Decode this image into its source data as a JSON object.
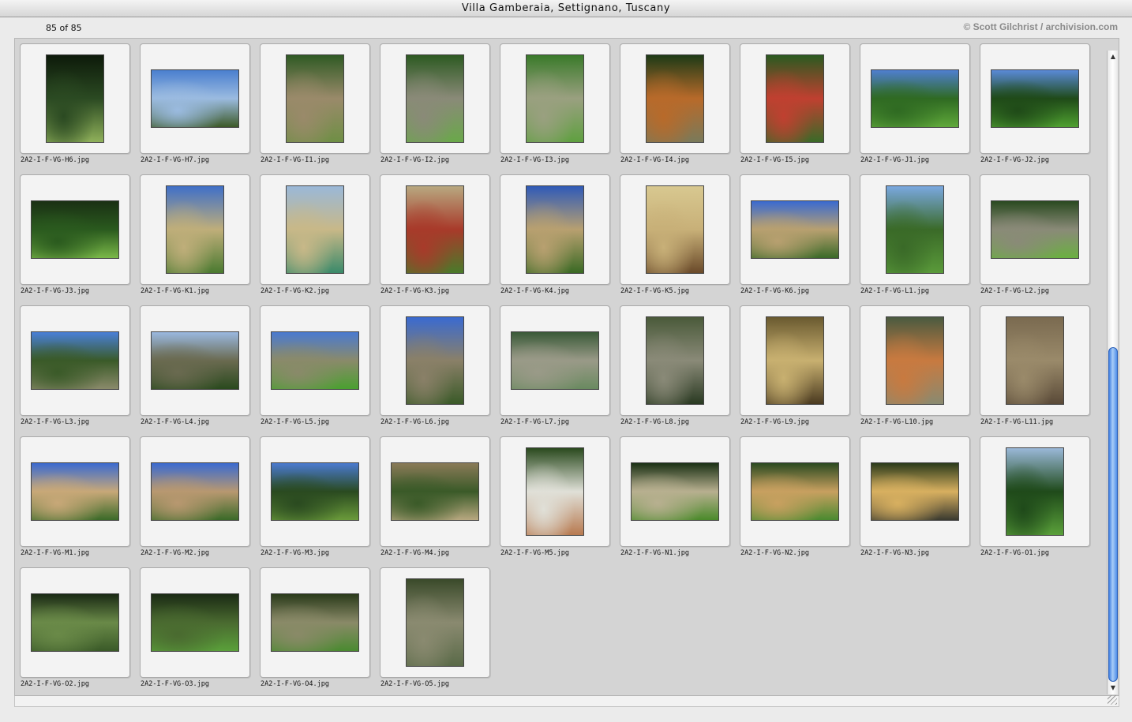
{
  "window": {
    "title": "Villa Gamberaia, Settignano, Tuscany"
  },
  "header": {
    "counter": "85 of 85",
    "copyright": "© Scott Gilchrist / archivision.com"
  },
  "scrollbar": {
    "up_icon": "triangle-up-icon",
    "down_icon": "triangle-down-icon",
    "position_fraction": 0.47
  },
  "thumbnails": [
    {
      "name": "2A2-I-F-VG-H6.jpg",
      "orientation": "portrait",
      "colors": [
        "#0d1a0a",
        "#2b4a22",
        "#8fb05a"
      ]
    },
    {
      "name": "2A2-I-F-VG-H7.jpg",
      "orientation": "landscape",
      "colors": [
        "#4a7fcf",
        "#9bbbe0",
        "#3d5a28"
      ]
    },
    {
      "name": "2A2-I-F-VG-I1.jpg",
      "orientation": "portrait",
      "colors": [
        "#2f5a24",
        "#9a8a6a",
        "#6f8f45"
      ]
    },
    {
      "name": "2A2-I-F-VG-I2.jpg",
      "orientation": "portrait",
      "colors": [
        "#2d5a22",
        "#8a8a78",
        "#6aa84a"
      ]
    },
    {
      "name": "2A2-I-F-VG-I3.jpg",
      "orientation": "portrait",
      "colors": [
        "#3a7a2a",
        "#9aa080",
        "#5fa040"
      ]
    },
    {
      "name": "2A2-I-F-VG-I4.jpg",
      "orientation": "portrait",
      "colors": [
        "#1d3a16",
        "#b86a2a",
        "#7a7a5a"
      ]
    },
    {
      "name": "2A2-I-F-VG-I5.jpg",
      "orientation": "portrait",
      "colors": [
        "#2a5a20",
        "#c04030",
        "#3a6a28"
      ]
    },
    {
      "name": "2A2-I-F-VG-J1.jpg",
      "orientation": "landscape",
      "colors": [
        "#4f7fd0",
        "#2f6a22",
        "#5fa83a"
      ]
    },
    {
      "name": "2A2-I-F-VG-J2.jpg",
      "orientation": "landscape",
      "colors": [
        "#5a8ad8",
        "#1f4a18",
        "#4fa030"
      ]
    },
    {
      "name": "2A2-I-F-VG-J3.jpg",
      "orientation": "landscape",
      "colors": [
        "#1a3014",
        "#2a5a1e",
        "#7ab848"
      ]
    },
    {
      "name": "2A2-I-F-VG-K1.jpg",
      "orientation": "portrait",
      "colors": [
        "#3f6fc8",
        "#bfae7a",
        "#4a7a30"
      ]
    },
    {
      "name": "2A2-I-F-VG-K2.jpg",
      "orientation": "portrait",
      "colors": [
        "#9ab8d8",
        "#c8b888",
        "#3a8a6a"
      ]
    },
    {
      "name": "2A2-I-F-VG-K3.jpg",
      "orientation": "portrait",
      "colors": [
        "#b8a880",
        "#a83a2a",
        "#4a7a2a"
      ]
    },
    {
      "name": "2A2-I-F-VG-K4.jpg",
      "orientation": "portrait",
      "colors": [
        "#2f5ab8",
        "#b8a070",
        "#3a6a24"
      ]
    },
    {
      "name": "2A2-I-F-VG-K5.jpg",
      "orientation": "portrait",
      "colors": [
        "#d8c890",
        "#c8b078",
        "#6a4a2a"
      ]
    },
    {
      "name": "2A2-I-F-VG-K6.jpg",
      "orientation": "landscape",
      "colors": [
        "#3a6ad0",
        "#b8a070",
        "#3a6a28"
      ]
    },
    {
      "name": "2A2-I-F-VG-L1.jpg",
      "orientation": "portrait",
      "colors": [
        "#7aa8e0",
        "#3a6a28",
        "#5a9a3a"
      ]
    },
    {
      "name": "2A2-I-F-VG-L2.jpg",
      "orientation": "landscape",
      "colors": [
        "#2a4a20",
        "#8a8a78",
        "#6ab040"
      ]
    },
    {
      "name": "2A2-I-F-VG-L3.jpg",
      "orientation": "landscape",
      "colors": [
        "#4a80d8",
        "#3a5a28",
        "#8a8a6a"
      ]
    },
    {
      "name": "2A2-I-F-VG-L4.jpg",
      "orientation": "landscape",
      "colors": [
        "#9ab8e0",
        "#6a6a50",
        "#2a4a1e"
      ]
    },
    {
      "name": "2A2-I-F-VG-L5.jpg",
      "orientation": "landscape",
      "colors": [
        "#4a7ad0",
        "#8a8a6a",
        "#4aa030"
      ]
    },
    {
      "name": "2A2-I-F-VG-L6.jpg",
      "orientation": "portrait",
      "colors": [
        "#3a6ad0",
        "#8a8068",
        "#3a5a28"
      ]
    },
    {
      "name": "2A2-I-F-VG-L7.jpg",
      "orientation": "landscape",
      "colors": [
        "#3a5a38",
        "#9a9a88",
        "#6a8a60"
      ]
    },
    {
      "name": "2A2-I-F-VG-L8.jpg",
      "orientation": "portrait",
      "colors": [
        "#4a5a3a",
        "#8a8a78",
        "#2a3a22"
      ]
    },
    {
      "name": "2A2-I-F-VG-L9.jpg",
      "orientation": "portrait",
      "colors": [
        "#6a5a30",
        "#c8b070",
        "#4a3a20"
      ]
    },
    {
      "name": "2A2-I-F-VG-L10.jpg",
      "orientation": "portrait",
      "colors": [
        "#4a5a40",
        "#c87a40",
        "#8a8a70"
      ]
    },
    {
      "name": "2A2-I-F-VG-L11.jpg",
      "orientation": "portrait",
      "colors": [
        "#7a6a50",
        "#9a8a6a",
        "#5a4a38"
      ]
    },
    {
      "name": "2A2-I-F-VG-M1.jpg",
      "orientation": "landscape",
      "colors": [
        "#3a6ad0",
        "#c8a878",
        "#3a6a28"
      ]
    },
    {
      "name": "2A2-I-F-VG-M2.jpg",
      "orientation": "landscape",
      "colors": [
        "#3a6ad0",
        "#b89870",
        "#3a6a28"
      ]
    },
    {
      "name": "2A2-I-F-VG-M3.jpg",
      "orientation": "landscape",
      "colors": [
        "#4a7ad0",
        "#2a4a20",
        "#6a9a3a"
      ]
    },
    {
      "name": "2A2-I-F-VG-M4.jpg",
      "orientation": "landscape",
      "colors": [
        "#8a7a58",
        "#3a5a28",
        "#b8a880"
      ]
    },
    {
      "name": "2A2-I-F-VG-M5.jpg",
      "orientation": "portrait",
      "colors": [
        "#2a4a1e",
        "#e0e0d8",
        "#b87a50"
      ]
    },
    {
      "name": "2A2-I-F-VG-N1.jpg",
      "orientation": "landscape",
      "colors": [
        "#1a3014",
        "#b8b090",
        "#4a8a2a"
      ]
    },
    {
      "name": "2A2-I-F-VG-N2.jpg",
      "orientation": "landscape",
      "colors": [
        "#2a4a20",
        "#c8a060",
        "#4a8a30"
      ]
    },
    {
      "name": "2A2-I-F-VG-N3.jpg",
      "orientation": "landscape",
      "colors": [
        "#2a3a1a",
        "#d8b060",
        "#3a3a30"
      ]
    },
    {
      "name": "2A2-I-F-VG-O1.jpg",
      "orientation": "portrait",
      "colors": [
        "#9ab8d8",
        "#1f4a1a",
        "#5aa03a"
      ]
    },
    {
      "name": "2A2-I-F-VG-O2.jpg",
      "orientation": "landscape",
      "colors": [
        "#1a2a14",
        "#6a8a48",
        "#3a5a28"
      ]
    },
    {
      "name": "2A2-I-F-VG-O3.jpg",
      "orientation": "landscape",
      "colors": [
        "#1a2a14",
        "#4a6a30",
        "#5aa03a"
      ]
    },
    {
      "name": "2A2-I-F-VG-O4.jpg",
      "orientation": "landscape",
      "colors": [
        "#2a3a1a",
        "#8a8a68",
        "#4a8a30"
      ]
    },
    {
      "name": "2A2-I-F-VG-O5.jpg",
      "orientation": "portrait",
      "colors": [
        "#3a4a2a",
        "#8a8a70",
        "#5a6a48"
      ]
    }
  ]
}
